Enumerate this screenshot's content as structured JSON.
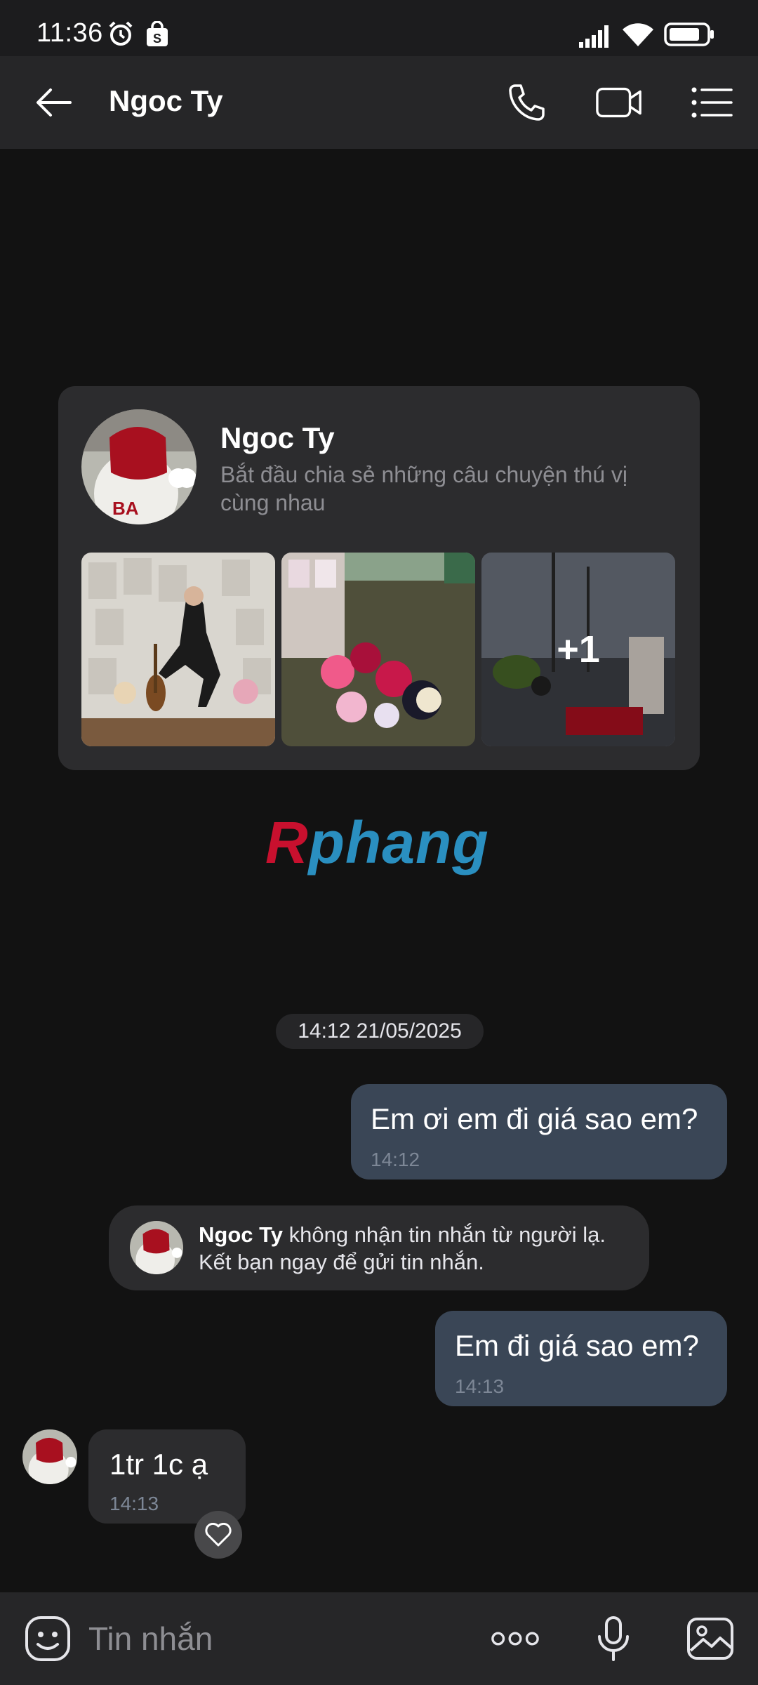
{
  "status_bar": {
    "time": "11:36",
    "icons": [
      "alarm-icon",
      "shopping-bag-icon",
      "signal-icon",
      "wifi-icon",
      "battery-icon"
    ]
  },
  "header": {
    "title": "Ngoc Ty",
    "icons": [
      "back-arrow-icon",
      "phone-icon",
      "video-call-icon",
      "menu-list-icon"
    ]
  },
  "profile_card": {
    "name": "Ngoc Ty",
    "subtitle": "Bắt đầu chia sẻ những câu chuyện thú vị cùng nhau",
    "more_photos_label": "+1"
  },
  "watermark": {
    "first_letter": "R",
    "rest": "phang"
  },
  "chat": {
    "date_separator": "14:12 21/05/2025",
    "messages": [
      {
        "direction": "out",
        "text": "Em ơi em đi giá sao em?",
        "time": "14:12"
      },
      {
        "direction": "out",
        "text": "Em đi giá sao em?",
        "time": "14:13"
      },
      {
        "direction": "in",
        "text": "1tr 1c ạ",
        "time": "14:13"
      }
    ],
    "notice": {
      "name": "Ngoc Ty",
      "text": " không nhận tin nhắn từ người lạ. Kết bạn ngay để gửi tin nhắn."
    }
  },
  "composer": {
    "placeholder": "Tin nhắn",
    "icons": [
      "sticker-icon",
      "more-dots-icon",
      "microphone-icon",
      "image-icon"
    ]
  },
  "colors": {
    "background": "#121212",
    "header": "#262628",
    "outgoing_bubble": "#3a4656",
    "incoming_bubble": "#2c2c2e",
    "muted_text": "#8e8e93"
  }
}
